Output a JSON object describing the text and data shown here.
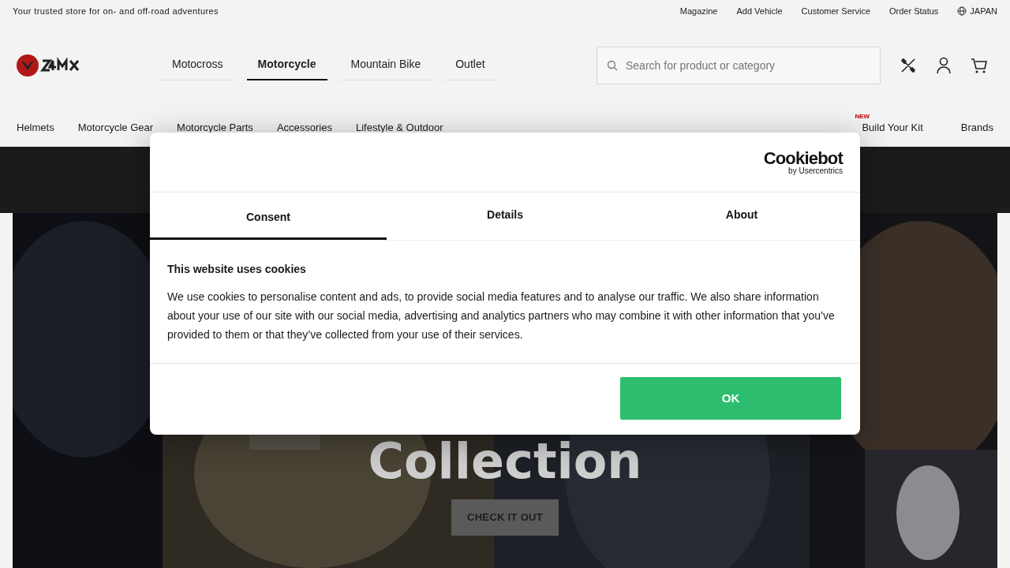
{
  "top_bar": {
    "tagline": "Your trusted store for on- and off-road adventures",
    "links": [
      "Magazine",
      "Add Vehicle",
      "Customer Service",
      "Order Status"
    ],
    "region": "JAPAN"
  },
  "header": {
    "sections": [
      {
        "label": "Motocross",
        "selected": false
      },
      {
        "label": "Motorcycle",
        "selected": true
      },
      {
        "label": "Mountain Bike",
        "selected": false
      },
      {
        "label": "Outlet",
        "selected": false
      }
    ],
    "search": {
      "placeholder": "Search for product or category"
    }
  },
  "category_nav": {
    "items": [
      "Helmets",
      "Motorcycle Gear",
      "Motorcycle Parts",
      "Accessories",
      "Lifestyle & Outdoor"
    ],
    "right_items": [
      {
        "label": "Build Your Kit",
        "badge": "NEW"
      },
      {
        "label": "Brands"
      }
    ]
  },
  "hero": {
    "kind": "picture",
    "title": "Collection",
    "button": "CHECK IT OUT"
  },
  "cookie_dialog": {
    "brand": "Cookiebot",
    "brand_sub": "by Usercentrics",
    "tabs": [
      {
        "label": "Consent",
        "selected": true
      },
      {
        "label": "Details",
        "selected": false
      },
      {
        "label": "About",
        "selected": false
      }
    ],
    "heading": "This website uses cookies",
    "body": "We use cookies to personalise content and ads, to provide social media features and to analyse our traffic. We also share information about your use of our site with our social media, advertising and analytics partners who may combine it with other information that you’ve provided to them or that they’ve collected from your use of their services.",
    "button": "OK"
  }
}
